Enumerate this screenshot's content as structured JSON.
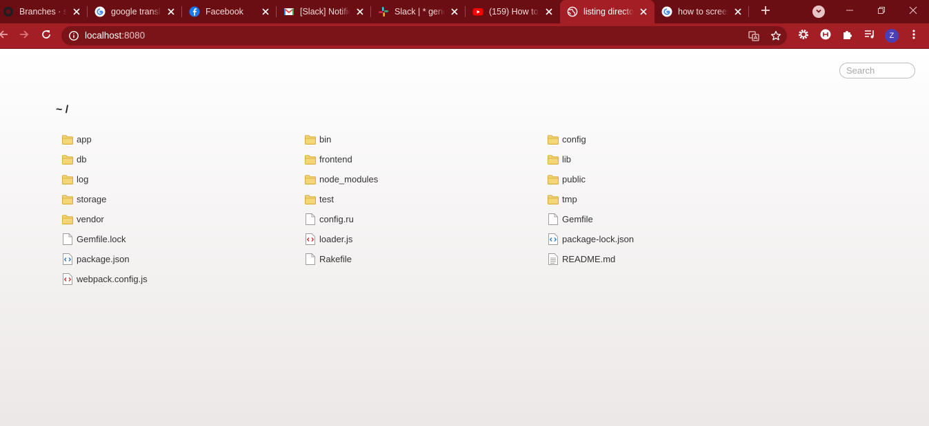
{
  "browser": {
    "tabs": [
      {
        "title": "Branches · set",
        "favicon": "github-icon"
      },
      {
        "title": "google transla",
        "favicon": "google-icon"
      },
      {
        "title": "Facebook",
        "favicon": "facebook-icon"
      },
      {
        "title": "[Slack] Notific",
        "favicon": "gmail-icon"
      },
      {
        "title": "Slack | * gene",
        "favicon": "slack-icon"
      },
      {
        "title": "(159) How to",
        "favicon": "youtube-icon"
      },
      {
        "title": "listing directo",
        "favicon": "globe-icon",
        "active": true
      },
      {
        "title": "how to screen",
        "favicon": "google-icon"
      }
    ],
    "address": {
      "host": "localhost",
      "port": ":8080"
    },
    "profile_initial": "Z",
    "colors": {
      "frame": "#6b0e14",
      "toolbar": "#a41e25",
      "omnibox": "#7a1419",
      "avatar": "#4b3fb5"
    }
  },
  "page": {
    "search_placeholder": "Search",
    "breadcrumb": "~ /",
    "files": [
      {
        "name": "app",
        "kind": "folder"
      },
      {
        "name": "bin",
        "kind": "folder"
      },
      {
        "name": "config",
        "kind": "folder"
      },
      {
        "name": "db",
        "kind": "folder"
      },
      {
        "name": "frontend",
        "kind": "folder"
      },
      {
        "name": "lib",
        "kind": "folder"
      },
      {
        "name": "log",
        "kind": "folder"
      },
      {
        "name": "node_modules",
        "kind": "folder"
      },
      {
        "name": "public",
        "kind": "folder"
      },
      {
        "name": "storage",
        "kind": "folder"
      },
      {
        "name": "test",
        "kind": "folder"
      },
      {
        "name": "tmp",
        "kind": "folder"
      },
      {
        "name": "vendor",
        "kind": "folder"
      },
      {
        "name": "config.ru",
        "kind": "file"
      },
      {
        "name": "Gemfile",
        "kind": "file"
      },
      {
        "name": "Gemfile.lock",
        "kind": "file"
      },
      {
        "name": "loader.js",
        "kind": "js"
      },
      {
        "name": "package-lock.json",
        "kind": "json"
      },
      {
        "name": "package.json",
        "kind": "json"
      },
      {
        "name": "Rakefile",
        "kind": "file"
      },
      {
        "name": "README.md",
        "kind": "text"
      },
      {
        "name": "webpack.config.js",
        "kind": "js"
      }
    ]
  }
}
